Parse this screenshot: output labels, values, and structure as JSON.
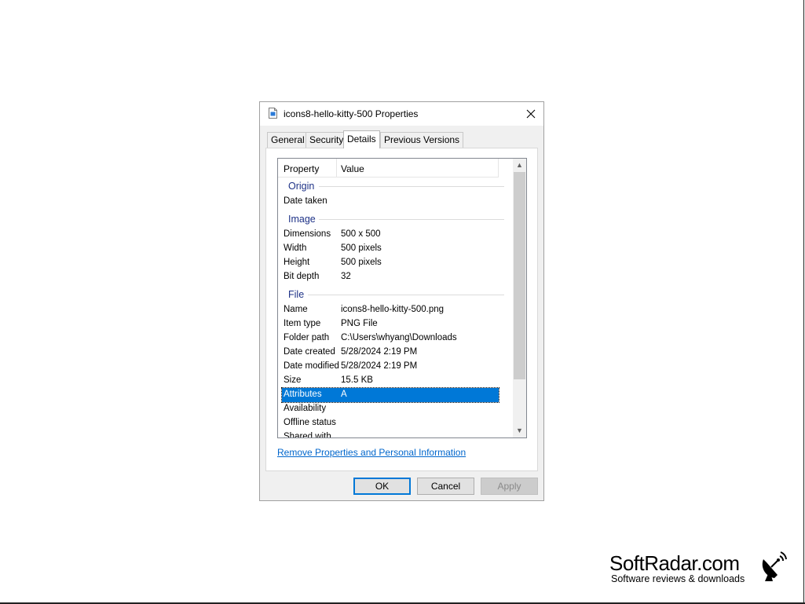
{
  "window": {
    "title": "icons8-hello-kitty-500 Properties",
    "icon": "file-image-icon",
    "close_icon": "close-icon"
  },
  "tabs": [
    {
      "label": "General",
      "active": false
    },
    {
      "label": "Security",
      "active": false
    },
    {
      "label": "Details",
      "active": true
    },
    {
      "label": "Previous Versions",
      "active": false
    }
  ],
  "list": {
    "columns": [
      "Property",
      "Value"
    ],
    "groups": {
      "origin": "Origin",
      "image": "Image",
      "file": "File"
    },
    "rows": {
      "date_taken": {
        "name": "Date taken",
        "value": ""
      },
      "dimensions": {
        "name": "Dimensions",
        "value": "500 x 500"
      },
      "width": {
        "name": "Width",
        "value": "500 pixels"
      },
      "height": {
        "name": "Height",
        "value": "500 pixels"
      },
      "bit_depth": {
        "name": "Bit depth",
        "value": "32"
      },
      "name": {
        "name": "Name",
        "value": "icons8-hello-kitty-500.png"
      },
      "item_type": {
        "name": "Item type",
        "value": "PNG File"
      },
      "folder_path": {
        "name": "Folder path",
        "value": "C:\\Users\\whyang\\Downloads"
      },
      "date_created": {
        "name": "Date created",
        "value": "5/28/2024 2:19 PM"
      },
      "date_modified": {
        "name": "Date modified",
        "value": "5/28/2024 2:19 PM"
      },
      "size": {
        "name": "Size",
        "value": "15.5 KB"
      },
      "attributes": {
        "name": "Attributes",
        "value": "A",
        "selected": true
      },
      "availability": {
        "name": "Availability",
        "value": ""
      },
      "offline_status": {
        "name": "Offline status",
        "value": ""
      },
      "shared_with": {
        "name": "Shared with",
        "value": ""
      }
    }
  },
  "remove_link": "Remove Properties and Personal Information",
  "buttons": {
    "ok": "OK",
    "cancel": "Cancel",
    "apply": "Apply"
  },
  "brand": {
    "name": "SoftRadar.com",
    "tagline": "Software reviews & downloads",
    "icon": "satellite-dish-icon"
  },
  "colors": {
    "accent": "#0078d7",
    "link": "#0066cc",
    "group_header": "#1e3287"
  }
}
